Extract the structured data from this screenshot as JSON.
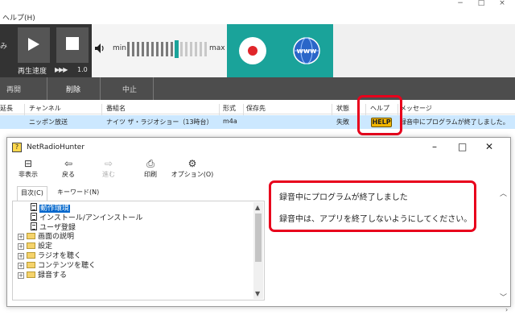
{
  "menu": {
    "help": "ヘルプ(H)"
  },
  "window_controls": {
    "minimize": "−",
    "maximize": "□",
    "close": "×"
  },
  "player": {
    "left_cut_text": "み",
    "speed_label": "再生速度",
    "speed_arrows": "▶▶▶",
    "speed_value": "1.0",
    "vol_min": "min",
    "vol_max": "max",
    "volume_level": 0.6
  },
  "buttons": {
    "record": "record",
    "www": "www"
  },
  "actionbar": {
    "replay": "再開",
    "delete": "削除",
    "stop": "中止"
  },
  "list": {
    "headers": {
      "delay": "延長",
      "channel": "チャンネル",
      "program": "番組名",
      "format": "形式",
      "save_to": "保存先",
      "status": "状態",
      "help": "ヘルプ",
      "message": "メッセージ"
    },
    "row": {
      "channel": "ニッポン放送",
      "program": "ナイツ ザ・ラジオショー（13時台）",
      "format": "m4a",
      "status": "失敗",
      "help_badge": "HELP",
      "message": "録音中にプログラムが終了しました。"
    }
  },
  "help_window": {
    "title": "NetRadioHunter",
    "controls": {
      "minimize": "–",
      "maximize": "□",
      "close": "✕"
    },
    "toolbar": [
      {
        "label": "非表示",
        "icon": "⊟"
      },
      {
        "label": "戻る",
        "icon": "⇦"
      },
      {
        "label": "進む",
        "icon": "⇨"
      },
      {
        "label": "印刷",
        "icon": "⎙"
      },
      {
        "label": "オプション(O)",
        "icon": "⚙"
      }
    ],
    "tabs": {
      "contents": "目次(C)",
      "keyword": "キーワード(N)"
    },
    "tree": {
      "operating_env": "動作環境",
      "install": "インストール/アンインストール",
      "user_reg": "ユーザ登録",
      "screen_desc": "画面の説明",
      "settings": "設定",
      "listen_radio": "ラジオを聴く",
      "listen_content": "コンテンツを聴く",
      "record": "録音する"
    },
    "messages": {
      "line1": "録音中にプログラムが終了しました",
      "line2": "録音中は、アプリを終了しないようにしてください。"
    }
  }
}
